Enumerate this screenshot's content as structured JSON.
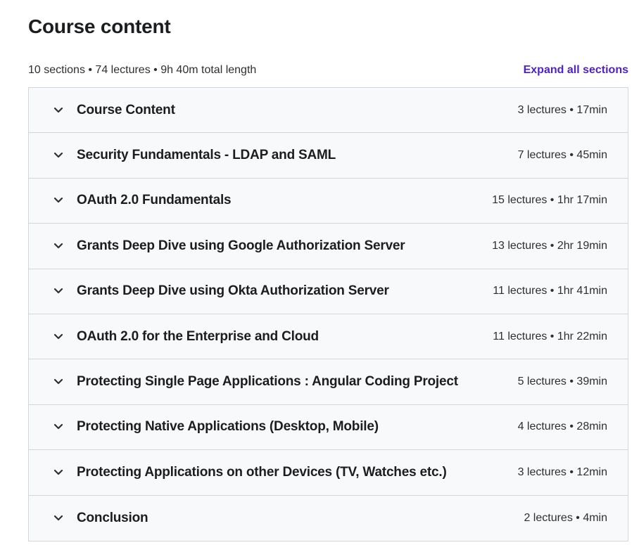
{
  "header": {
    "title": "Course content"
  },
  "summary": {
    "text": "10 sections • 74 lectures • 9h 40m total length",
    "expand_label": "Expand all sections"
  },
  "colors": {
    "accent": "#5022c3",
    "row_background": "#f7f9fa",
    "border": "#d1d7dc"
  },
  "sections": [
    {
      "title": "Course Content",
      "meta": "3 lectures • 17min"
    },
    {
      "title": "Security Fundamentals - LDAP and SAML",
      "meta": "7 lectures • 45min"
    },
    {
      "title": "OAuth 2.0 Fundamentals",
      "meta": "15 lectures • 1hr 17min"
    },
    {
      "title": "Grants Deep Dive using Google Authorization Server",
      "meta": "13 lectures • 2hr 19min"
    },
    {
      "title": "Grants Deep Dive using Okta Authorization Server",
      "meta": "11 lectures • 1hr 41min"
    },
    {
      "title": "OAuth 2.0 for the Enterprise and Cloud",
      "meta": "11 lectures • 1hr 22min"
    },
    {
      "title": "Protecting Single Page Applications : Angular Coding Project",
      "meta": "5 lectures • 39min"
    },
    {
      "title": "Protecting Native Applications (Desktop, Mobile)",
      "meta": "4 lectures • 28min"
    },
    {
      "title": "Protecting Applications on other Devices (TV, Watches etc.)",
      "meta": "3 lectures • 12min"
    },
    {
      "title": "Conclusion",
      "meta": "2 lectures • 4min"
    }
  ],
  "icons": {
    "section_toggle": "chevron-down-icon"
  }
}
